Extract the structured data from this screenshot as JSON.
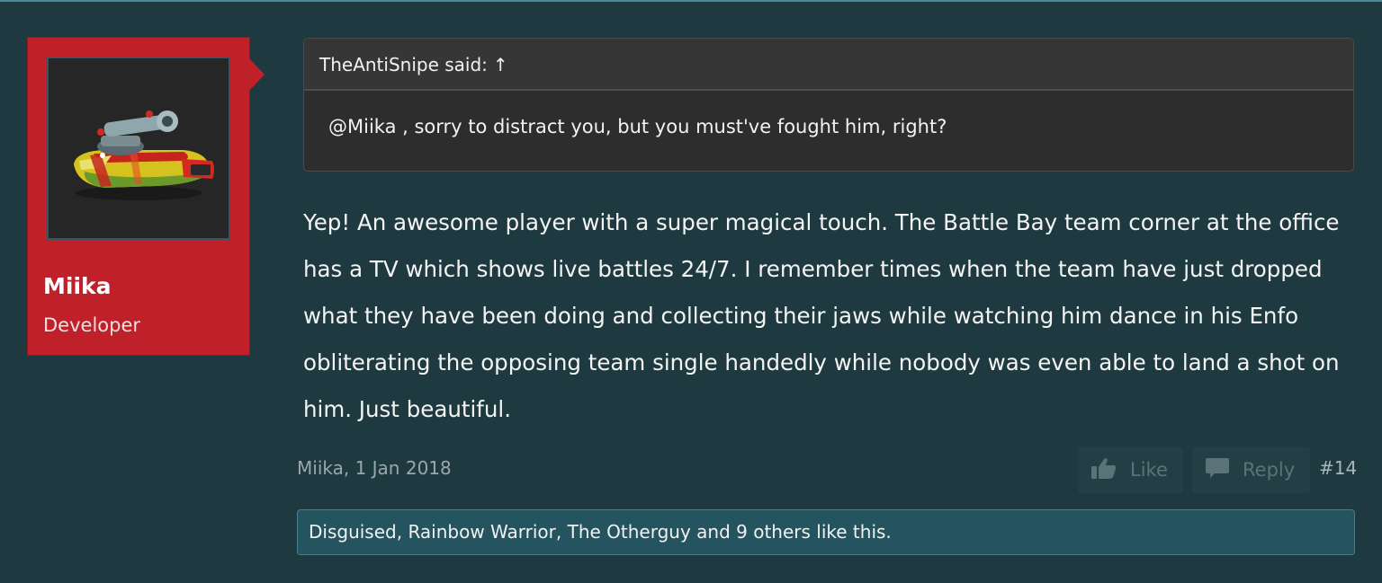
{
  "author": {
    "name": "Miika",
    "title": "Developer",
    "card_color": "#c0202a"
  },
  "quote": {
    "author_label": "TheAntiSnipe said:",
    "jump_icon": "↑",
    "text": "@Miika , sorry to distract you, but you must've fought him, right?"
  },
  "message": {
    "text": "Yep! An awesome player with a super magical touch. The Battle Bay team corner at the office has a TV which shows live battles 24/7. I remember times when the team have just dropped what they have been doing and collecting their jaws while watching him dance in his Enfo obliterating the opposing team single handedly while nobody was even able to land a shot on him. Just beautiful."
  },
  "footer": {
    "meta": "Miika, 1 Jan 2018",
    "like_label": "Like",
    "reply_label": "Reply",
    "post_number": "#14",
    "like_icon": "thumbs-up-icon",
    "reply_icon": "speech-bubble-icon"
  },
  "likes": {
    "text": "Disguised, Rainbow Warrior, The Otherguy and 9 others like this."
  }
}
